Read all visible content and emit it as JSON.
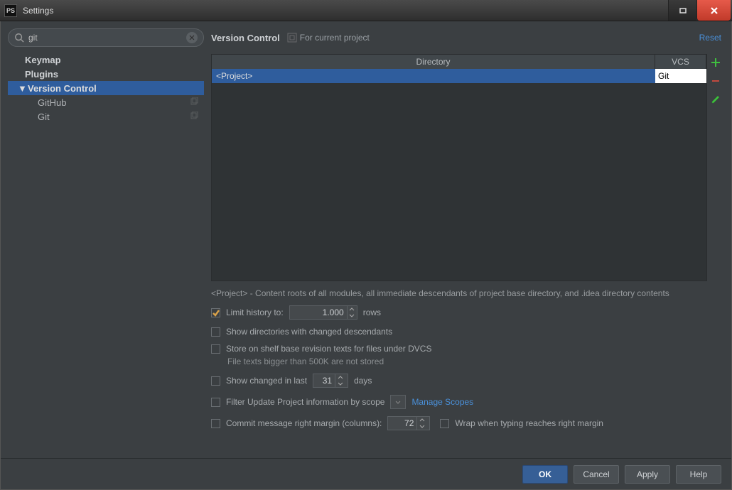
{
  "title": "Settings",
  "app_badge": "PS",
  "search": {
    "value": "git"
  },
  "tree": {
    "items": [
      {
        "label": "Keymap"
      },
      {
        "label": "Plugins"
      }
    ],
    "vc_label": "Version Control",
    "vc_children": [
      {
        "label": "GitHub"
      },
      {
        "label": "Git"
      }
    ]
  },
  "header": {
    "title": "Version Control",
    "scope": "For current project",
    "reset": "Reset"
  },
  "table": {
    "columns": {
      "dir": "Directory",
      "vcs": "VCS"
    },
    "rows": [
      {
        "dir": "<Project>",
        "vcs": "Git"
      }
    ]
  },
  "hint_project": "<Project> - Content roots of all modules, all immediate descendants of project base directory, and .idea directory contents",
  "opts": {
    "limit_history": {
      "checked": true,
      "label_pre": "Limit history to:",
      "value": "1.000",
      "label_post": "rows"
    },
    "show_dirs": {
      "checked": false,
      "label": "Show directories with changed descendants"
    },
    "store_shelf": {
      "checked": false,
      "label": "Store on shelf base revision texts for files under DVCS",
      "sub": "File texts bigger than 500K are not stored"
    },
    "show_changed": {
      "checked": false,
      "label_pre": "Show changed in last",
      "value": "31",
      "label_post": "days"
    },
    "filter_scope": {
      "checked": false,
      "label": "Filter Update Project information by scope",
      "link": "Manage Scopes"
    },
    "commit_margin": {
      "checked": false,
      "label": "Commit message right margin (columns):",
      "value": "72",
      "wrap_checked": false,
      "wrap_label": "Wrap when typing reaches right margin"
    }
  },
  "buttons": {
    "ok": "OK",
    "cancel": "Cancel",
    "apply": "Apply",
    "help": "Help"
  }
}
